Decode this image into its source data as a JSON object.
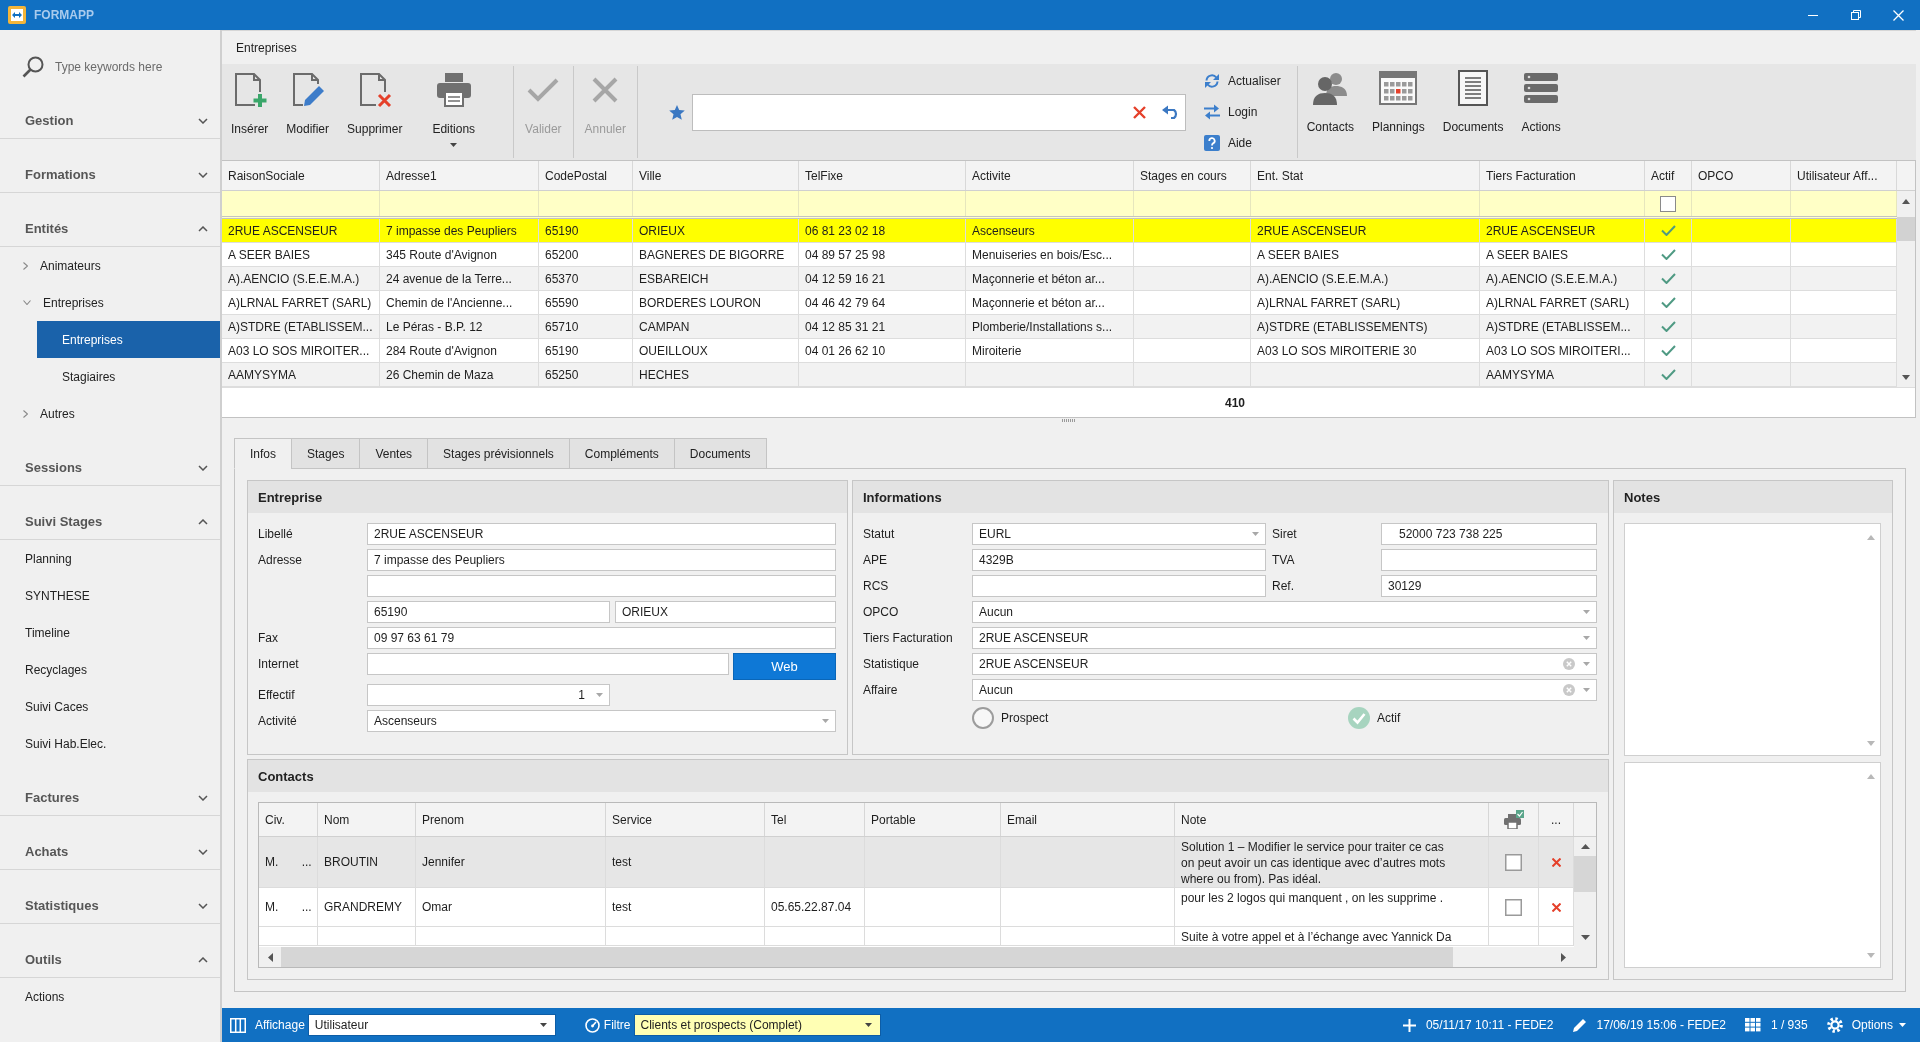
{
  "window": {
    "title": "FORMAPP"
  },
  "sidebar": {
    "search": {
      "placeholder": "Type keywords here"
    },
    "groups": [
      {
        "label": "Gestion",
        "expanded": false
      },
      {
        "label": "Formations",
        "expanded": false
      },
      {
        "label": "Entités",
        "expanded": true,
        "items": [
          {
            "label": "Animateurs",
            "expanded": false,
            "selected": false
          },
          {
            "label": "Entreprises",
            "expanded": true,
            "selected": false,
            "children": [
              {
                "label": "Entreprises",
                "selected": true
              },
              {
                "label": "Stagiaires",
                "selected": false
              }
            ]
          },
          {
            "label": "Autres",
            "expanded": false,
            "selected": false
          }
        ]
      },
      {
        "label": "Sessions",
        "expanded": false
      },
      {
        "label": "Suivi Stages",
        "expanded": true,
        "items": [
          {
            "label": "Planning",
            "selected": false
          },
          {
            "label": "SYNTHESE",
            "selected": false
          },
          {
            "label": "Timeline",
            "selected": false
          },
          {
            "label": "Recyclages",
            "selected": false
          },
          {
            "label": "Suivi Caces",
            "selected": false
          },
          {
            "label": "Suivi Hab.Elec.",
            "selected": false
          }
        ]
      },
      {
        "label": "Factures",
        "expanded": false
      },
      {
        "label": "Achats",
        "expanded": false
      },
      {
        "label": "Statistiques",
        "expanded": false
      },
      {
        "label": "Outils",
        "expanded": true,
        "items": [
          {
            "label": "Actions",
            "selected": false
          }
        ]
      }
    ]
  },
  "module": {
    "title": "Entreprises"
  },
  "toolbar": {
    "groups": [
      {
        "buttons": [
          {
            "label": "Insérer",
            "disabled": false,
            "dropdown": false
          },
          {
            "label": "Modifier",
            "disabled": false,
            "dropdown": false
          },
          {
            "label": "Supprimer",
            "disabled": false,
            "dropdown": false
          },
          {
            "label": "Editions",
            "disabled": false,
            "dropdown": true
          }
        ]
      },
      {
        "buttons": [
          {
            "label": "Valider",
            "disabled": true,
            "dropdown": false
          }
        ]
      },
      {
        "buttons": [
          {
            "label": "Annuler",
            "disabled": true,
            "dropdown": false
          }
        ]
      }
    ],
    "quick_actions": [
      "Actualiser",
      "Login",
      "Aide"
    ],
    "modules": [
      "Contacts",
      "Plannings",
      "Documents",
      "Actions"
    ]
  },
  "grid": {
    "columns": [
      {
        "label": "RaisonSociale",
        "kind": "text"
      },
      {
        "label": "Adresse1",
        "kind": "text"
      },
      {
        "label": "CodePostal",
        "kind": "text"
      },
      {
        "label": "Ville",
        "kind": "text"
      },
      {
        "label": "TelFixe",
        "kind": "text"
      },
      {
        "label": "Activite",
        "kind": "text"
      },
      {
        "label": "Stages en cours",
        "kind": "text",
        "summary": "410"
      },
      {
        "label": "Ent. Stat",
        "kind": "text"
      },
      {
        "label": "Tiers Facturation",
        "kind": "text"
      },
      {
        "label": "Actif",
        "kind": "check",
        "filter_checked": false
      },
      {
        "label": "OPCO",
        "kind": "text"
      },
      {
        "label": "Utilisateur Aff...",
        "kind": "text"
      }
    ],
    "rows": [
      {
        "selected": true,
        "cells": [
          "2RUE ASCENSEUR",
          "7 impasse des Peupliers",
          "65190",
          "ORIEUX",
          "06 81 23 02 18",
          "Ascenseurs",
          null,
          "2RUE ASCENSEUR",
          "2RUE ASCENSEUR",
          {
            "checked": true
          },
          null,
          null
        ]
      },
      {
        "selected": false,
        "cells": [
          "A SEER BAIES",
          "345 Route d'Avignon",
          "65200",
          "BAGNERES DE BIGORRE",
          "04 89 57 25 98",
          "Menuiseries en bois/Esc...",
          null,
          "A SEER BAIES",
          "A SEER BAIES",
          {
            "checked": true
          },
          null,
          null
        ]
      },
      {
        "selected": false,
        "cells": [
          "A).AENCIO (S.E.E.M.A.)",
          "24 avenue de la Terre...",
          "65370",
          "ESBAREICH",
          "04 12 59 16 21",
          "Maçonnerie et béton ar...",
          null,
          "A).AENCIO (S.E.E.M.A.)",
          "A).AENCIO (S.E.E.M.A.)",
          {
            "checked": true
          },
          null,
          null
        ]
      },
      {
        "selected": false,
        "cells": [
          "A)LRNAL FARRET (SARL)",
          "Chemin de l'Ancienne...",
          "65590",
          "BORDERES LOURON",
          "04 46 42 79 64",
          "Maçonnerie et béton ar...",
          null,
          "A)LRNAL FARRET (SARL)",
          "A)LRNAL FARRET (SARL)",
          {
            "checked": true
          },
          null,
          null
        ]
      },
      {
        "selected": false,
        "cells": [
          "A)STDRE (ETABLISSEM...",
          "Le Péras - B.P. 12",
          "65710",
          "CAMPAN",
          "04 12 85 31 21",
          "Plomberie/Installations s...",
          null,
          "A)STDRE (ETABLISSEMENTS)",
          "A)STDRE (ETABLISSEM...",
          {
            "checked": true
          },
          null,
          null
        ]
      },
      {
        "selected": false,
        "cells": [
          "A03 LO SOS MIROITER...",
          "284 Route d'Avignon",
          "65190",
          "OUEILLOUX",
          "04 01 26 62 10",
          "Miroiterie",
          null,
          "A03 LO SOS MIROITERIE 30",
          "A03 LO SOS MIROITERI...",
          {
            "checked": true
          },
          null,
          null
        ]
      },
      {
        "selected": false,
        "cells": [
          "AAMYSYMA",
          "26 Chemin de Maza",
          "65250",
          "HECHES",
          null,
          null,
          null,
          null,
          "AAMYSYMA",
          {
            "checked": true
          },
          null,
          null
        ]
      }
    ]
  },
  "tabs": [
    {
      "label": "Infos",
      "selected": true
    },
    {
      "label": "Stages",
      "selected": false
    },
    {
      "label": "Ventes",
      "selected": false
    },
    {
      "label": "Stages prévisionnels",
      "selected": false
    },
    {
      "label": "Compléments",
      "selected": false
    },
    {
      "label": "Documents",
      "selected": false
    }
  ],
  "entreprise": {
    "title": "Entreprise",
    "libelle": {
      "label": "Libellé",
      "value": "2RUE ASCENSEUR"
    },
    "adresse": {
      "label": "Adresse",
      "line1": "7 impasse des Peupliers",
      "code_postal": "65190",
      "ville": "ORIEUX"
    },
    "fax": {
      "label": "Fax",
      "value": "09 97 63 61 79"
    },
    "internet": {
      "label": "Internet",
      "button": "Web"
    },
    "effectif": {
      "label": "Effectif",
      "value": "1"
    },
    "activite": {
      "label": "Activité",
      "value": "Ascenseurs"
    }
  },
  "informations": {
    "title": "Informations",
    "statut": {
      "label": "Statut",
      "value": "EURL"
    },
    "siret": {
      "label": "Siret",
      "value": "52000 723 738 225"
    },
    "ape": {
      "label": "APE",
      "value": "4329B"
    },
    "tva": {
      "label": "TVA"
    },
    "rcs": {
      "label": "RCS"
    },
    "ref": {
      "label": "Ref.",
      "value": "30129"
    },
    "opco": {
      "label": "OPCO",
      "value": "Aucun"
    },
    "tiers_facturation": {
      "label": "Tiers Facturation",
      "value": "2RUE ASCENSEUR"
    },
    "statistique": {
      "label": "Statistique",
      "value": "2RUE ASCENSEUR"
    },
    "affaire": {
      "label": "Affaire",
      "value": "Aucun"
    },
    "prospect": {
      "label": "Prospect",
      "checked": false
    },
    "actif": {
      "label": "Actif",
      "checked": true
    }
  },
  "notes": {
    "title": "Notes"
  },
  "contacts": {
    "title": "Contacts",
    "columns": [
      {
        "label": "Civ.",
        "kind": "civ"
      },
      {
        "label": "Nom",
        "kind": "text"
      },
      {
        "label": "Prenom",
        "kind": "text"
      },
      {
        "label": "Service",
        "kind": "text"
      },
      {
        "label": "Tel",
        "kind": "text"
      },
      {
        "label": "Portable",
        "kind": "text"
      },
      {
        "label": "Email",
        "kind": "text"
      },
      {
        "label": "Note",
        "kind": "note"
      },
      {
        "kind": "check"
      },
      {
        "label": "...",
        "kind": "delete"
      }
    ],
    "rows": [
      {
        "selected": true,
        "cells": [
          "M. ...",
          "BROUTIN",
          "Jennifer",
          "test",
          null,
          null,
          null,
          [
            "Solution 1 – Modifier le service pour traiter ce cas",
            "on peut avoir un cas identique avec d’autres mots",
            "where ou from). Pas idéal."
          ],
          {
            "checked": false
          },
          null
        ]
      },
      {
        "selected": false,
        "cells": [
          "M. ...",
          "GRANDREMY",
          "Omar",
          "test",
          "05.65.22.87.04",
          null,
          null,
          [
            "pour les 2 logos qui manquent , on les supprime ."
          ],
          {
            "checked": false
          },
          null
        ]
      },
      {
        "selected": false,
        "cells": [
          null,
          null,
          null,
          null,
          null,
          null,
          null,
          [
            "Suite à votre appel et à l’échange avec Yannick Da"
          ],
          null,
          null
        ]
      }
    ]
  },
  "status_bar": {
    "affichage": {
      "label": "Affichage",
      "value": "Utilisateur"
    },
    "filtre": {
      "label": "Filtre",
      "value": "Clients et prospects (Complet)"
    },
    "created": "05/11/17 10:11 - FEDE2",
    "modified": "17/06/19 15:06 - FEDE2",
    "record": "1 / 935",
    "options": "Options"
  }
}
